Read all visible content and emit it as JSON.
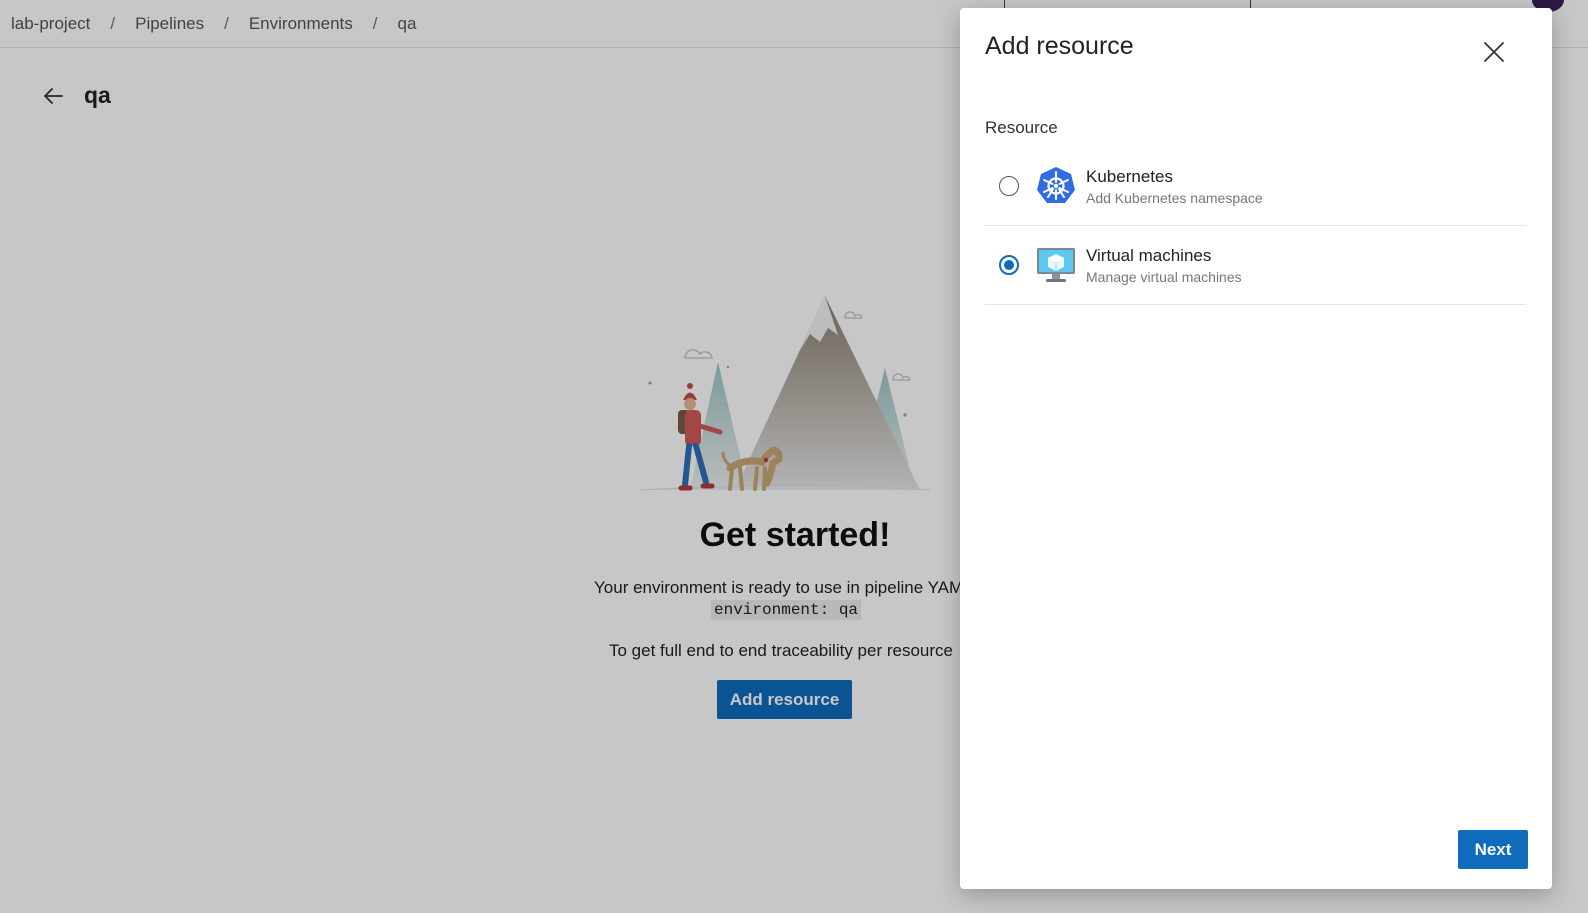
{
  "breadcrumb": {
    "items": [
      "lab-project",
      "Pipelines",
      "Environments",
      "qa"
    ],
    "separator": "/"
  },
  "environment": {
    "title": "qa"
  },
  "empty_state": {
    "heading": "Get started!",
    "line1": "Your environment is ready to use in pipeline YAM",
    "code": "environment: qa",
    "line2": "To get full end to end traceability per resource",
    "button_label": "Add resource"
  },
  "panel": {
    "title": "Add resource",
    "section_label": "Resource",
    "options": [
      {
        "title": "Kubernetes",
        "subtitle": "Add Kubernetes namespace",
        "icon": "kubernetes-icon",
        "selected": false
      },
      {
        "title": "Virtual machines",
        "subtitle": "Manage virtual machines",
        "icon": "virtual-machine-icon",
        "selected": true
      }
    ],
    "next_label": "Next"
  },
  "colors": {
    "accent": "#0f6cbd",
    "kubernetes": "#326ce5"
  }
}
